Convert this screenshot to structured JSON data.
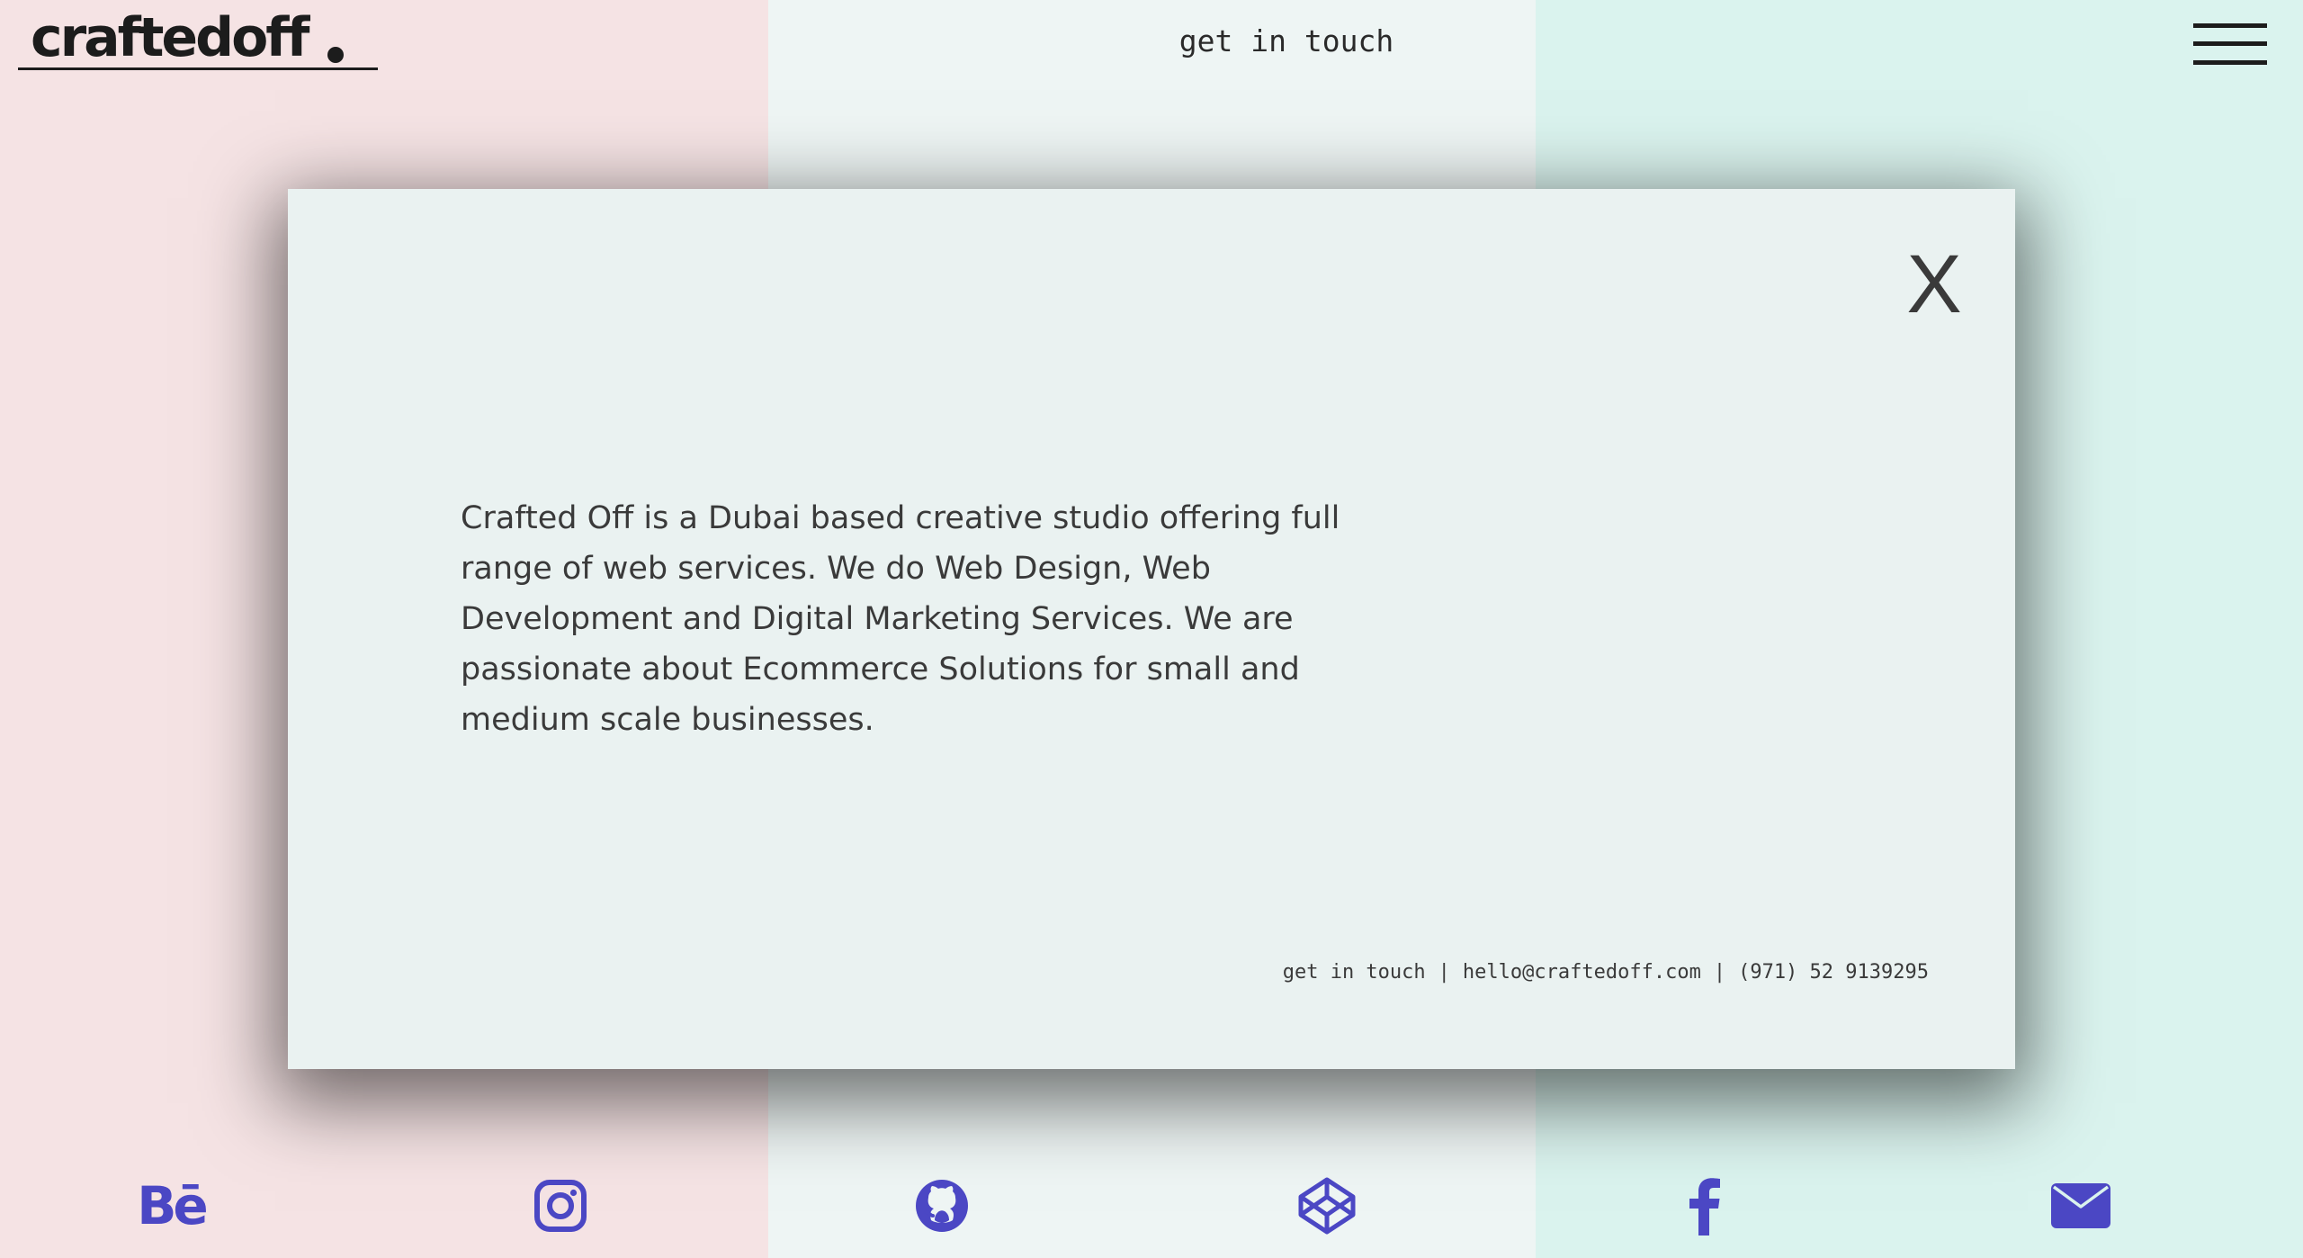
{
  "colors": {
    "col_left_bg": "#f5e3e4",
    "col_middle_bg": "#eef5f4",
    "col_right_bg": "#daf3ee",
    "modal_bg": "#eaf2f1",
    "icon_accent": "#4b47c4",
    "text": "#3a3a3a"
  },
  "header": {
    "logo": "craftedoff",
    "nav_link": "get in touch",
    "menu_icon": "hamburger-menu-icon"
  },
  "modal": {
    "close_label": "X",
    "about": "Crafted Off is a Dubai based creative studio offering full range of web services. We do Web Design, Web Development and Digital Marketing Services. We are passionate about Ecommerce Solutions for small and medium scale businesses.",
    "contact": {
      "label": "get in touch",
      "email": "hello@craftedoff.com",
      "phone": "(971) 52 9139295",
      "separator": "|"
    }
  },
  "footer": {
    "social": [
      {
        "name": "behance",
        "glyph": "Bē"
      },
      {
        "name": "instagram"
      },
      {
        "name": "github"
      },
      {
        "name": "codepen"
      },
      {
        "name": "facebook"
      },
      {
        "name": "email"
      }
    ]
  }
}
